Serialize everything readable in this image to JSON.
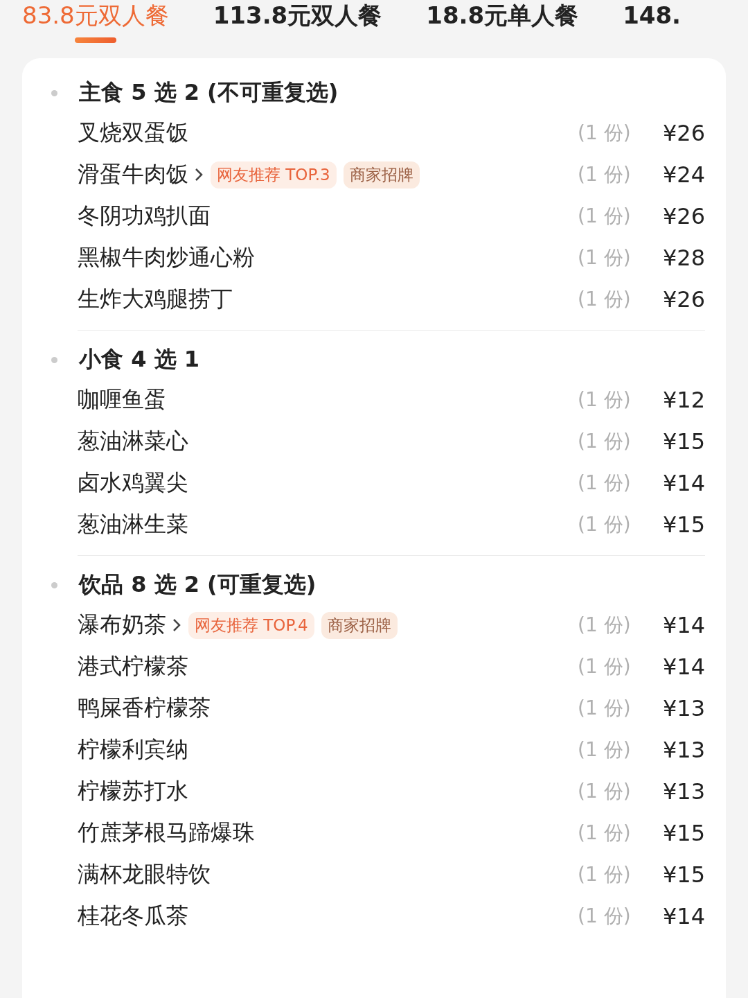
{
  "tabs": [
    {
      "label": "83.8元双人餐",
      "selected": true
    },
    {
      "label": "113.8元双人餐",
      "selected": false
    },
    {
      "label": "18.8元单人餐",
      "selected": false
    },
    {
      "label": "148.",
      "selected": false
    }
  ],
  "sections": [
    {
      "title": "主食 5 选 2 (不可重复选)",
      "items": [
        {
          "name": "叉烧双蛋饭",
          "has_detail": false,
          "qty": "(1 份)",
          "price": "¥26"
        },
        {
          "name": "滑蛋牛肉饭",
          "has_detail": true,
          "badges": [
            {
              "text": "网友推荐 TOP.3",
              "kind": "rank"
            },
            {
              "text": "商家招牌",
              "kind": "signature"
            }
          ],
          "qty": "(1 份)",
          "price": "¥24"
        },
        {
          "name": "冬阴功鸡扒面",
          "has_detail": false,
          "qty": "(1 份)",
          "price": "¥26"
        },
        {
          "name": "黑椒牛肉炒通心粉",
          "has_detail": false,
          "qty": "(1 份)",
          "price": "¥28"
        },
        {
          "name": "生炸大鸡腿捞丁",
          "has_detail": false,
          "qty": "(1 份)",
          "price": "¥26"
        }
      ]
    },
    {
      "title": "小食 4 选 1",
      "items": [
        {
          "name": "咖喱鱼蛋",
          "has_detail": false,
          "qty": "(1 份)",
          "price": "¥12"
        },
        {
          "name": "葱油淋菜心",
          "has_detail": false,
          "qty": "(1 份)",
          "price": "¥15"
        },
        {
          "name": "卤水鸡翼尖",
          "has_detail": false,
          "qty": "(1 份)",
          "price": "¥14"
        },
        {
          "name": "葱油淋生菜",
          "has_detail": false,
          "qty": "(1 份)",
          "price": "¥15"
        }
      ]
    },
    {
      "title": "饮品 8 选 2 (可重复选)",
      "items": [
        {
          "name": "瀑布奶茶",
          "has_detail": true,
          "badges": [
            {
              "text": "网友推荐 TOP.4",
              "kind": "rank"
            },
            {
              "text": "商家招牌",
              "kind": "signature"
            }
          ],
          "qty": "(1 份)",
          "price": "¥14"
        },
        {
          "name": "港式柠檬茶",
          "has_detail": false,
          "qty": "(1 份)",
          "price": "¥14"
        },
        {
          "name": "鸭屎香柠檬茶",
          "has_detail": false,
          "qty": "(1 份)",
          "price": "¥13"
        },
        {
          "name": "柠檬利宾纳",
          "has_detail": false,
          "qty": "(1 份)",
          "price": "¥13"
        },
        {
          "name": "柠檬苏打水",
          "has_detail": false,
          "qty": "(1 份)",
          "price": "¥13"
        },
        {
          "name": "竹蔗茅根马蹄爆珠",
          "has_detail": false,
          "qty": "(1 份)",
          "price": "¥15"
        },
        {
          "name": "满杯龙眼特饮",
          "has_detail": false,
          "qty": "(1 份)",
          "price": "¥15"
        },
        {
          "name": "桂花冬瓜茶",
          "has_detail": false,
          "qty": "(1 份)",
          "price": "¥14"
        }
      ]
    }
  ]
}
